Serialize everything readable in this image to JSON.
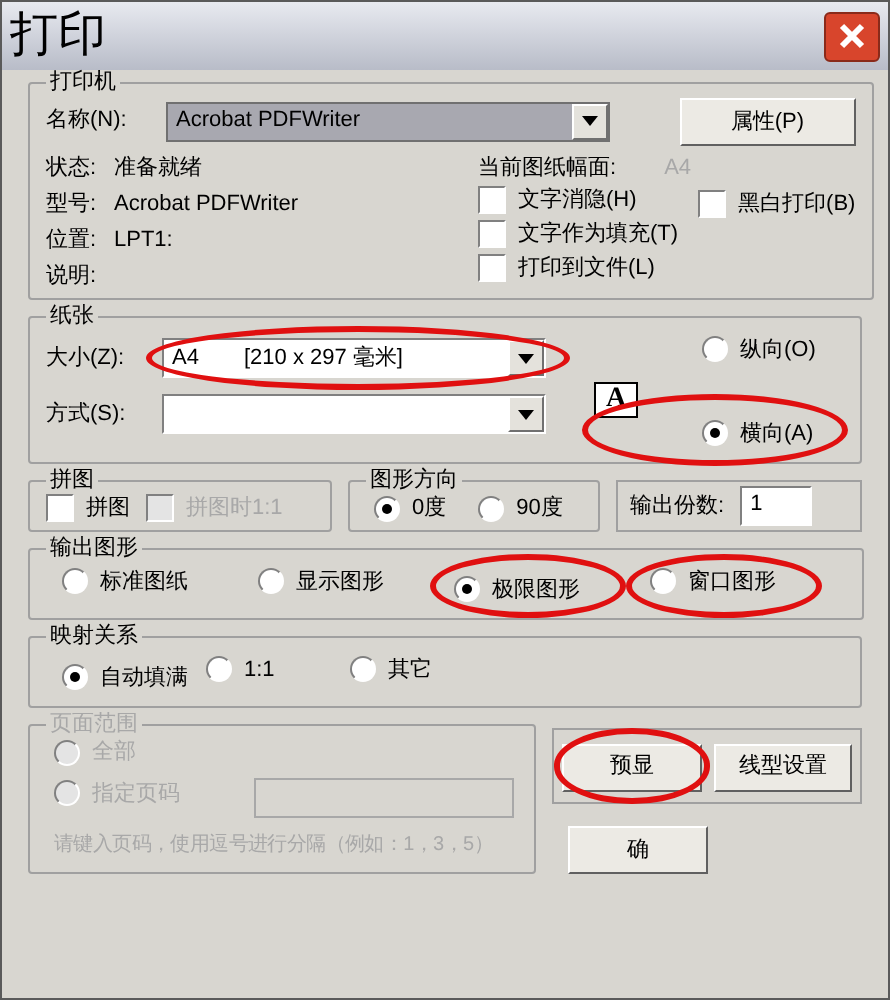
{
  "window": {
    "title": "打印"
  },
  "printer": {
    "title": "打印机",
    "name_label": "名称(N):",
    "name_value": "Acrobat PDFWriter",
    "properties_button": "属性(P)",
    "info": [
      {
        "label": "状态:",
        "value": "准备就绪"
      },
      {
        "label": "型号:",
        "value": "Acrobat PDFWriter"
      },
      {
        "label": "位置:",
        "value": "LPT1:"
      },
      {
        "label": "说明:"
      }
    ],
    "paper_size_label": "当前图纸幅面:",
    "paper_size_value": "A4",
    "options": [
      {
        "label": "文字消隐(H)",
        "checked": false
      },
      {
        "label": "文字作为填充(T)",
        "checked": false
      },
      {
        "label": "打印到文件(L)",
        "checked": false
      }
    ],
    "bw_option": {
      "label": "黑白打印(B)",
      "checked": false
    }
  },
  "paper": {
    "title": "纸张",
    "size_label": "大小(Z):",
    "size_value": "A4",
    "size_dims": "[210 x 297 毫米]",
    "size_circled": true,
    "method_label": "方式(S):",
    "orientation_icon_letter": "A",
    "orientation": [
      {
        "label": "纵向(O)",
        "selected": false,
        "circled": false
      },
      {
        "label": "横向(A)",
        "selected": true,
        "circled": true
      }
    ]
  },
  "tiling": {
    "title": "拼图",
    "options": [
      {
        "label": "拼图",
        "checked": false,
        "disabled": false
      },
      {
        "label": "拼图时1:1",
        "checked": false,
        "disabled": true
      }
    ]
  },
  "graphic_direction": {
    "title": "图形方向",
    "options": [
      {
        "label": "0度",
        "selected": true
      },
      {
        "label": "90度",
        "selected": false
      }
    ]
  },
  "copies": {
    "label": "输出份数:",
    "value": "1"
  },
  "output": {
    "title": "输出图形",
    "options": [
      {
        "label": "标准图纸",
        "selected": false,
        "circled": false
      },
      {
        "label": "显示图形",
        "selected": false,
        "circled": false
      },
      {
        "label": "极限图形",
        "selected": true,
        "circled": true
      },
      {
        "label": "窗口图形",
        "selected": false,
        "circled": true
      }
    ]
  },
  "mapping": {
    "title": "映射关系",
    "options": [
      {
        "label": "自动填满",
        "selected": true
      },
      {
        "label": "1:1",
        "selected": false
      },
      {
        "label": "其它",
        "selected": false
      }
    ]
  },
  "page_range": {
    "title": "页面范围",
    "disabled": true,
    "options": [
      {
        "label": "全部",
        "selected": false
      },
      {
        "label": "指定页码",
        "selected": false
      }
    ],
    "hint": "请键入页码，使用逗号进行分隔（例如：1，3，5）"
  },
  "buttons": [
    {
      "label": "预显",
      "circled": true
    },
    {
      "label": "线型设置",
      "circled": false
    }
  ],
  "ok_button": "确"
}
